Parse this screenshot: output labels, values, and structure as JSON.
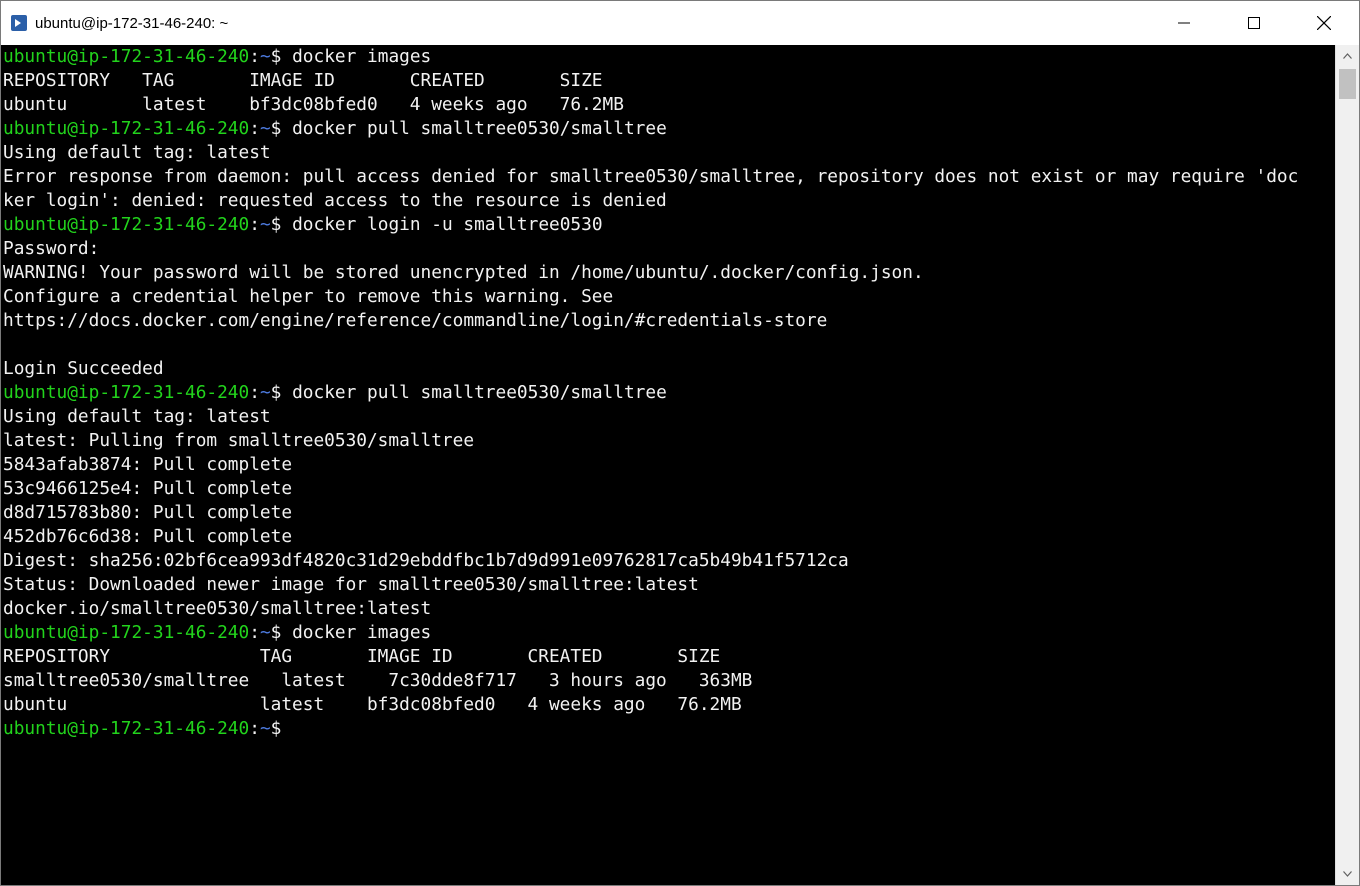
{
  "window": {
    "title": "ubuntu@ip-172-31-46-240: ~",
    "minimize": "minimize",
    "maximize": "maximize",
    "close": "close",
    "app_icon": "powershell-icon"
  },
  "prompt": {
    "user_host": "ubuntu@ip-172-31-46-240",
    "sep": ":",
    "path": "~",
    "dollar": "$ "
  },
  "lines": [
    {
      "type": "prompt",
      "cmd": "docker images"
    },
    {
      "type": "out",
      "text": "REPOSITORY   TAG       IMAGE ID       CREATED       SIZE"
    },
    {
      "type": "out",
      "text": "ubuntu       latest    bf3dc08bfed0   4 weeks ago   76.2MB"
    },
    {
      "type": "prompt",
      "cmd": "docker pull smalltree0530/smalltree"
    },
    {
      "type": "out",
      "text": "Using default tag: latest"
    },
    {
      "type": "out",
      "text": "Error response from daemon: pull access denied for smalltree0530/smalltree, repository does not exist or may require 'doc"
    },
    {
      "type": "out",
      "text": "ker login': denied: requested access to the resource is denied"
    },
    {
      "type": "prompt",
      "cmd": "docker login -u smalltree0530"
    },
    {
      "type": "out",
      "text": "Password:"
    },
    {
      "type": "out",
      "text": "WARNING! Your password will be stored unencrypted in /home/ubuntu/.docker/config.json."
    },
    {
      "type": "out",
      "text": "Configure a credential helper to remove this warning. See"
    },
    {
      "type": "out",
      "text": "https://docs.docker.com/engine/reference/commandline/login/#credentials-store"
    },
    {
      "type": "out",
      "text": ""
    },
    {
      "type": "out",
      "text": "Login Succeeded"
    },
    {
      "type": "prompt",
      "cmd": "docker pull smalltree0530/smalltree"
    },
    {
      "type": "out",
      "text": "Using default tag: latest"
    },
    {
      "type": "out",
      "text": "latest: Pulling from smalltree0530/smalltree"
    },
    {
      "type": "out",
      "text": "5843afab3874: Pull complete"
    },
    {
      "type": "out",
      "text": "53c9466125e4: Pull complete"
    },
    {
      "type": "out",
      "text": "d8d715783b80: Pull complete"
    },
    {
      "type": "out",
      "text": "452db76c6d38: Pull complete"
    },
    {
      "type": "out",
      "text": "Digest: sha256:02bf6cea993df4820c31d29ebddfbc1b7d9d991e09762817ca5b49b41f5712ca"
    },
    {
      "type": "out",
      "text": "Status: Downloaded newer image for smalltree0530/smalltree:latest"
    },
    {
      "type": "out",
      "text": "docker.io/smalltree0530/smalltree:latest"
    },
    {
      "type": "prompt",
      "cmd": "docker images"
    },
    {
      "type": "out",
      "text": "REPOSITORY              TAG       IMAGE ID       CREATED       SIZE"
    },
    {
      "type": "out",
      "text": "smalltree0530/smalltree   latest    7c30dde8f717   3 hours ago   363MB"
    },
    {
      "type": "out",
      "text": "ubuntu                  latest    bf3dc08bfed0   4 weeks ago   76.2MB"
    },
    {
      "type": "prompt",
      "cmd": ""
    }
  ],
  "colors": {
    "prompt_user": "#22d31c",
    "prompt_path": "#4d7be0",
    "text": "#f2f2f2",
    "background": "#000000"
  }
}
